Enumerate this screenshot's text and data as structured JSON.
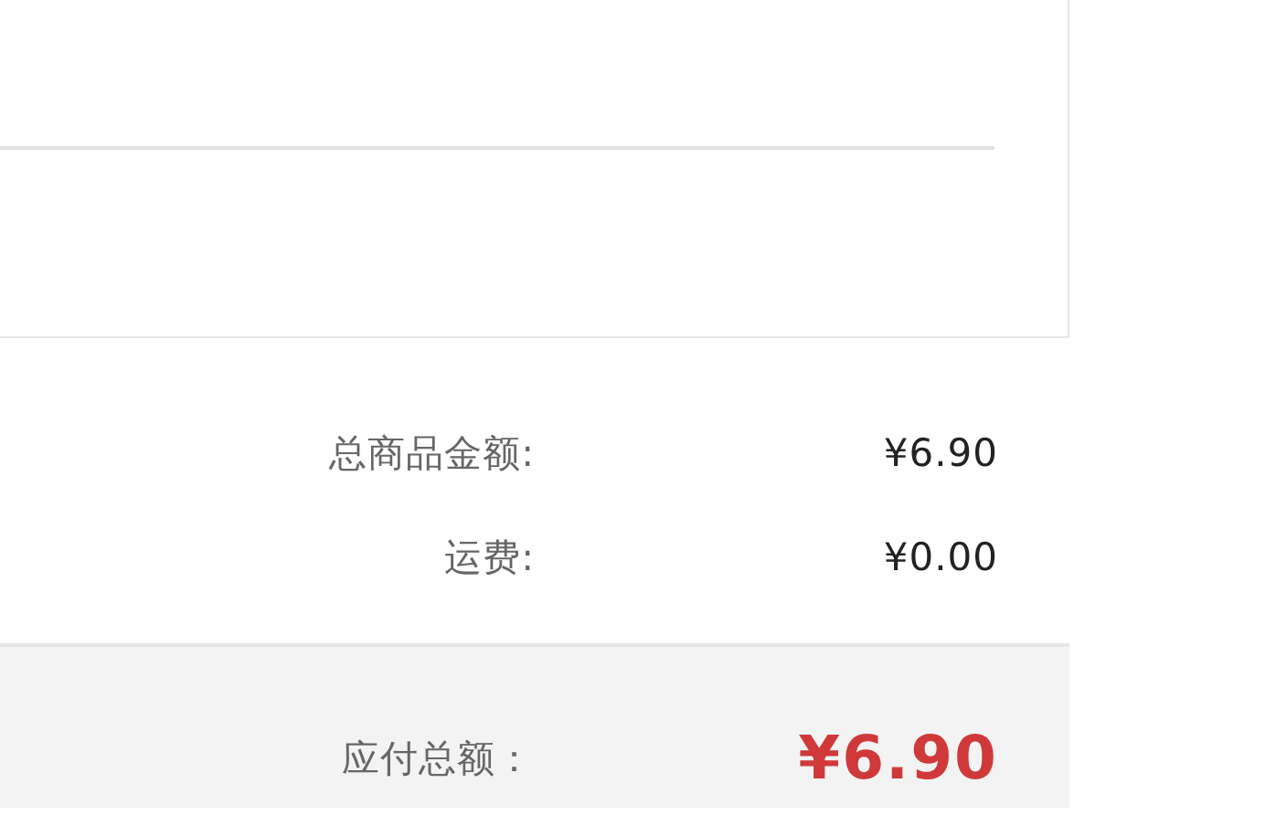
{
  "summary_rows": [
    {
      "label": "总商品金额:",
      "value": "¥6.90"
    },
    {
      "label": "运费:",
      "value": "¥0.00"
    }
  ],
  "total": {
    "label": "应付总额：",
    "value": "¥6.90"
  }
}
